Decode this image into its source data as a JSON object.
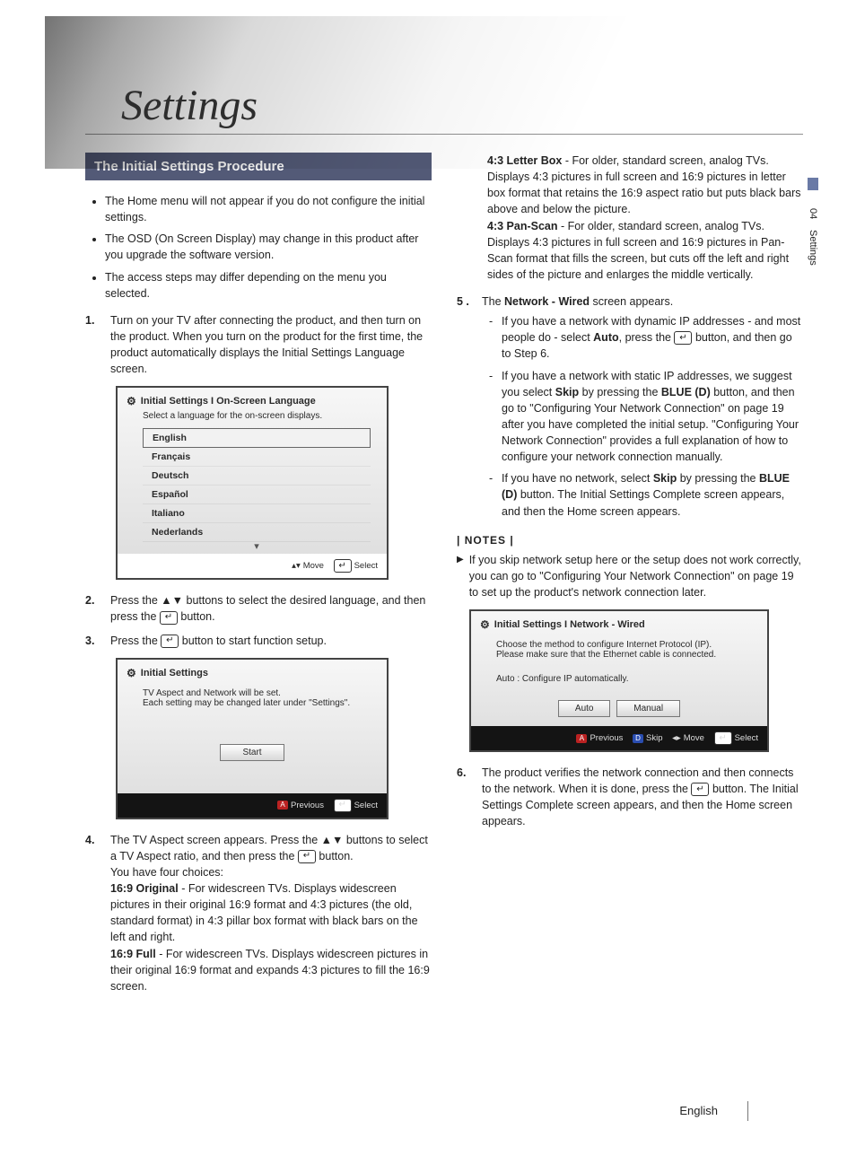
{
  "page": {
    "title": "Settings",
    "section_tab_number": "04",
    "section_tab_label": "Settings",
    "footer_language": "English"
  },
  "section_heading": "The Initial Settings Procedure",
  "intro_bullets": [
    "The Home menu will not appear if you do not configure the initial settings.",
    "The OSD (On Screen Display) may change in this product after you upgrade the software version.",
    "The access steps may differ depending on the menu you selected."
  ],
  "steps_left": {
    "s1": "Turn on your TV after connecting the product, and then turn on the product. When you turn on the product for the first time, the product automatically displays the Initial Settings Language screen.",
    "s2_a": "Press the ▲▼ buttons to select the desired language, and then press the ",
    "s2_b": " button.",
    "s3_a": "Press the ",
    "s3_b": " button to start function setup.",
    "s4_a": "The TV Aspect screen appears. Press the ▲▼ buttons to select a TV Aspect ratio, and then press the ",
    "s4_b": " button.",
    "s4_c": "You have four choices:",
    "s4_d_label": "16:9 Original",
    "s4_d_text": " - For widescreen TVs. Displays widescreen pictures in their original 16:9 format and 4:3 pictures (the old, standard format) in 4:3 pillar box format with black bars on the left and right.",
    "s4_e_label": "16:9 Full",
    "s4_e_text": " - For widescreen TVs. Displays widescreen pictures in their original 16:9 format and expands 4:3 pictures to fill the 16:9 screen."
  },
  "right": {
    "lb_label": "4:3 Letter Box",
    "lb_text": " - For older, standard screen, analog TVs. Displays 4:3 pictures in full screen and 16:9 pictures in letter box format that retains the 16:9 aspect ratio but puts black bars above and below the picture.",
    "ps_label": "4:3 Pan-Scan",
    "ps_text": " - For older, standard screen, analog TVs. Displays 4:3 pictures in full screen and 16:9 pictures in Pan-Scan format that fills the screen, but cuts off the left and right sides of the picture and enlarges the middle vertically.",
    "s5_a": "The ",
    "s5_b_label": "Network - Wired",
    "s5_c": " screen appears.",
    "s5_i1_a": "If you have a network with dynamic IP addresses - and most people do - select ",
    "s5_i1_b": "Auto",
    "s5_i1_c": ", press the ",
    "s5_i1_d": " button, and then go to Step 6.",
    "s5_i2_a": "If you have a network with static IP addresses, we suggest you select ",
    "s5_i2_b": "Skip",
    "s5_i2_c": " by pressing the ",
    "s5_i2_d": "BLUE (D)",
    "s5_i2_e": " button, and then go to \"Configuring Your Network Connection\" on page 19 after you have completed the initial setup. \"Configuring Your Network Connection\" provides a full explanation of how to configure your network connection manually.",
    "s5_i3_a": "If you have no network, select ",
    "s5_i3_b": "Skip",
    "s5_i3_c": " by pressing the ",
    "s5_i3_d": "BLUE (D)",
    "s5_i3_e": " button. The Initial Settings Complete screen appears, and then the Home screen appears.",
    "notes_head": "| NOTES |",
    "note1": "If you skip network setup here or the setup does not work correctly, you can go to \"Configuring Your Network Connection\" on page 19 to set up the product's network connection later.",
    "s6_a": "The product verifies the network connection and then connects to the network. When it is done, press the ",
    "s6_b": " button. The Initial Settings Complete screen appears, and then the Home screen appears."
  },
  "ui_language": {
    "header": "Initial Settings I On-Screen Language",
    "subtitle": "Select a language for the on-screen displays.",
    "options": [
      "English",
      "Français",
      "Deutsch",
      "Español",
      "Italiano",
      "Nederlands"
    ],
    "foot_move": "Move",
    "foot_select": "Select"
  },
  "ui_setup": {
    "header": "Initial Settings",
    "line1": "TV Aspect and Network will be set.",
    "line2": "Each setting may be changed later under \"Settings\".",
    "start": "Start",
    "foot_previous": "Previous",
    "foot_select": "Select"
  },
  "ui_network": {
    "header": "Initial Settings I Network - Wired",
    "line1": "Choose the method to configure Internet Protocol (IP).",
    "line2": "Please make sure that the Ethernet cable is connected.",
    "line3": "Auto : Configure IP automatically.",
    "btn_auto": "Auto",
    "btn_manual": "Manual",
    "foot_previous": "Previous",
    "foot_skip": "Skip",
    "foot_move": "Move",
    "foot_select": "Select"
  }
}
